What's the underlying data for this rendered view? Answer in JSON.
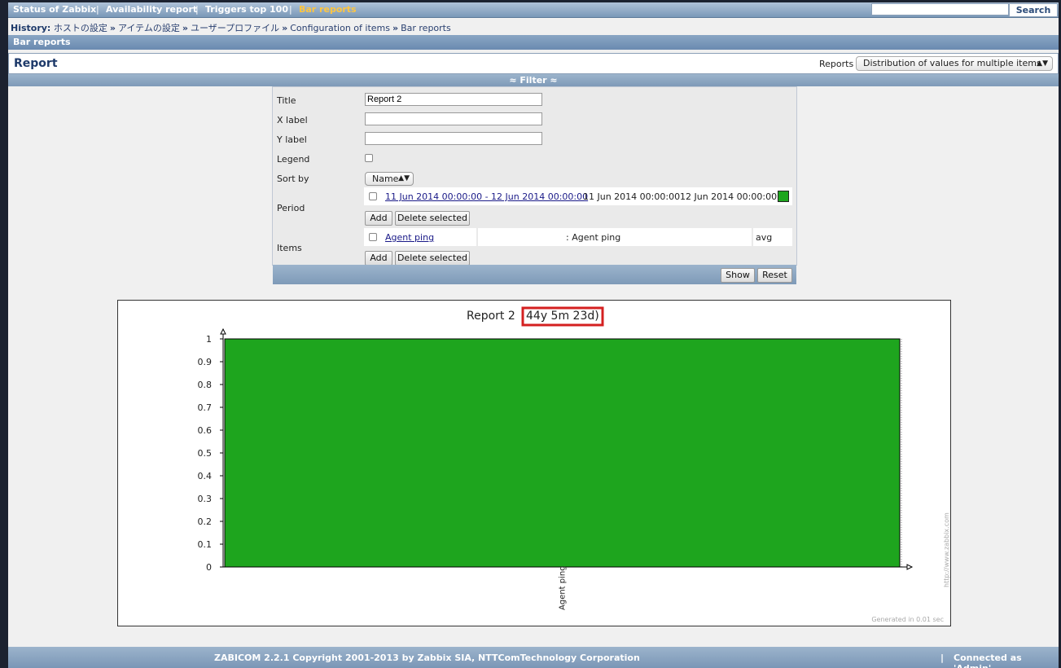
{
  "menu": {
    "items": [
      "Status of Zabbix",
      "Availability report",
      "Triggers top 100",
      "Bar reports"
    ],
    "separator": "|",
    "active": "Bar reports",
    "search_value": "",
    "search_button": "Search"
  },
  "history": {
    "label": "History:",
    "links": [
      "ホストの設定",
      "アイテムの設定",
      "ユーザープロファイル",
      "Configuration of items",
      "Bar reports"
    ],
    "arrow": "»"
  },
  "section_title": "Bar reports",
  "report": {
    "title": "Report",
    "reports_label": "Reports",
    "reports_selected": "Distribution of values for multiple items"
  },
  "filter": {
    "header": "≈ Filter ≈",
    "labels": {
      "title": "Title",
      "xlabel": "X label",
      "ylabel": "Y label",
      "legend": "Legend",
      "sortby": "Sort by",
      "period": "Period",
      "items": "Items"
    },
    "values": {
      "title": "Report 2",
      "xlabel": "",
      "ylabel": "",
      "legend_checked": false,
      "sortby": "Name"
    },
    "period_row": {
      "range": "11 Jun 2014 00:00:00 - 12 Jun 2014 00:00:00",
      "from": "11 Jun 2014 00:00:00",
      "to": "12 Jun 2014 00:00:00",
      "color": "#1ea51e"
    },
    "items_row": {
      "item": "Agent ping",
      "host": ": Agent ping",
      "func": "avg"
    },
    "add_label": "Add",
    "delete_label": "Delete selected",
    "show_label": "Show",
    "reset_label": "Reset"
  },
  "chart_data": {
    "type": "bar",
    "title": "Report 2",
    "title_highlight": "44y 5m 23d)",
    "categories": [
      "Agent ping"
    ],
    "values": [
      1
    ],
    "ylim": [
      0,
      1
    ],
    "yticks": [
      "0",
      "0.1",
      "0.2",
      "0.3",
      "0.4",
      "0.5",
      "0.6",
      "0.7",
      "0.8",
      "0.9",
      "1"
    ],
    "bar_color": "#1ea51e",
    "highlight_color": "#d42020",
    "watermark": "http://www.zabbix.com",
    "generated": "Generated in 0.01 sec"
  },
  "footer": {
    "copyright": "ZABICOM 2.2.1 Copyright 2001-2013 by Zabbix SIA, NTTComTechnology Corporation",
    "separator": "|",
    "connected": "Connected as 'Admin'"
  }
}
